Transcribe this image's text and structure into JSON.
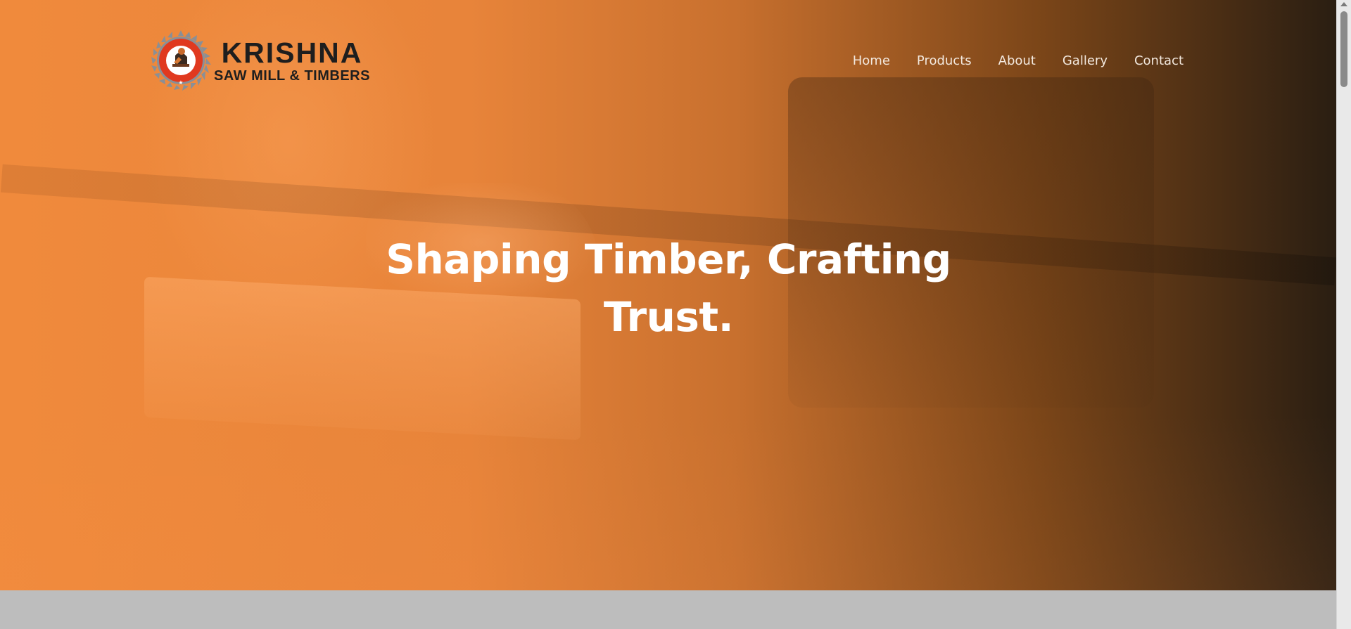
{
  "brand": {
    "name": "KRISHNA",
    "tagline": "SAW MILL & TIMBERS",
    "badge_ring_text": "KRISHNA SAW MILL & TIMBERS",
    "colors": {
      "badge_ring": "#e0391f",
      "badge_teeth": "#8a8f96",
      "text": "#1e1e1e"
    }
  },
  "nav": {
    "items": [
      {
        "label": "Home"
      },
      {
        "label": "Products"
      },
      {
        "label": "About"
      },
      {
        "label": "Gallery"
      },
      {
        "label": "Contact"
      }
    ]
  },
  "hero": {
    "headline_line1": "Shaping Timber, Crafting",
    "headline_line2": "Trust.",
    "overlay_colors": [
      "#f08a3c",
      "#2a1e12"
    ]
  },
  "icons": {
    "logo": "saw-blade-badge-icon",
    "scroll_up": "scroll-up-arrow-icon"
  }
}
